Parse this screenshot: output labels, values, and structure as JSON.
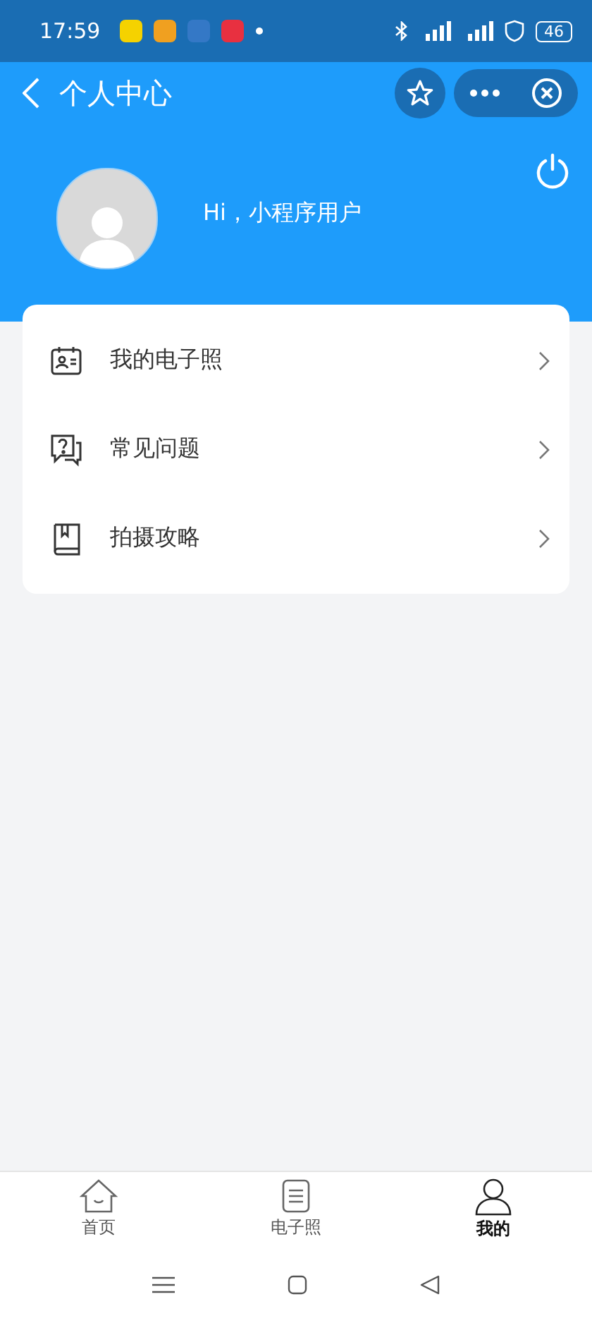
{
  "status_bar": {
    "time": "17:59",
    "battery": "46"
  },
  "nav_bar": {
    "title": "个人中心"
  },
  "profile": {
    "greeting": "Hi，小程序用户"
  },
  "menu": [
    {
      "kind": "id-card",
      "label": "我的电子照"
    },
    {
      "kind": "question",
      "label": "常见问题"
    },
    {
      "kind": "book",
      "label": "拍摄攻略"
    }
  ],
  "tab_bar": [
    {
      "kind": "home",
      "label": "首页",
      "selected": false
    },
    {
      "kind": "document",
      "label": "电子照",
      "selected": false
    },
    {
      "kind": "person",
      "label": "我的",
      "selected": true
    }
  ]
}
